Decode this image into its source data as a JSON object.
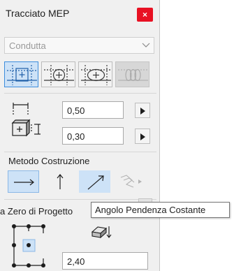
{
  "window": {
    "title": "Tracciato MEP",
    "close_symbol": "×"
  },
  "type_dropdown": {
    "value": "Condutta"
  },
  "element_type_buttons": [
    {
      "name": "rectangular-duct",
      "selected": true
    },
    {
      "name": "round-duct",
      "selected": false
    },
    {
      "name": "oval-duct",
      "selected": false
    },
    {
      "name": "flexible-duct",
      "selected": false,
      "disabled": true
    }
  ],
  "dimensions": {
    "width": "0,50",
    "height": "0,30"
  },
  "construction_method": {
    "label": "Metodo Costruzione",
    "buttons": [
      {
        "name": "horizontal",
        "selected": true
      },
      {
        "name": "vertical",
        "selected": false
      },
      {
        "name": "constant-slope",
        "hovered": true
      },
      {
        "name": "polyline",
        "disabled": true
      }
    ]
  },
  "reference": {
    "label": "a Zero di Progetto",
    "offset_value": "2,40"
  },
  "tooltip": {
    "text": "Angolo Pendenza Costante"
  },
  "colors": {
    "selected_fill": "#cde2f7",
    "selected_border": "#3d8ddc",
    "icon_blue": "#1f5fa8",
    "close_red": "#e81123"
  }
}
